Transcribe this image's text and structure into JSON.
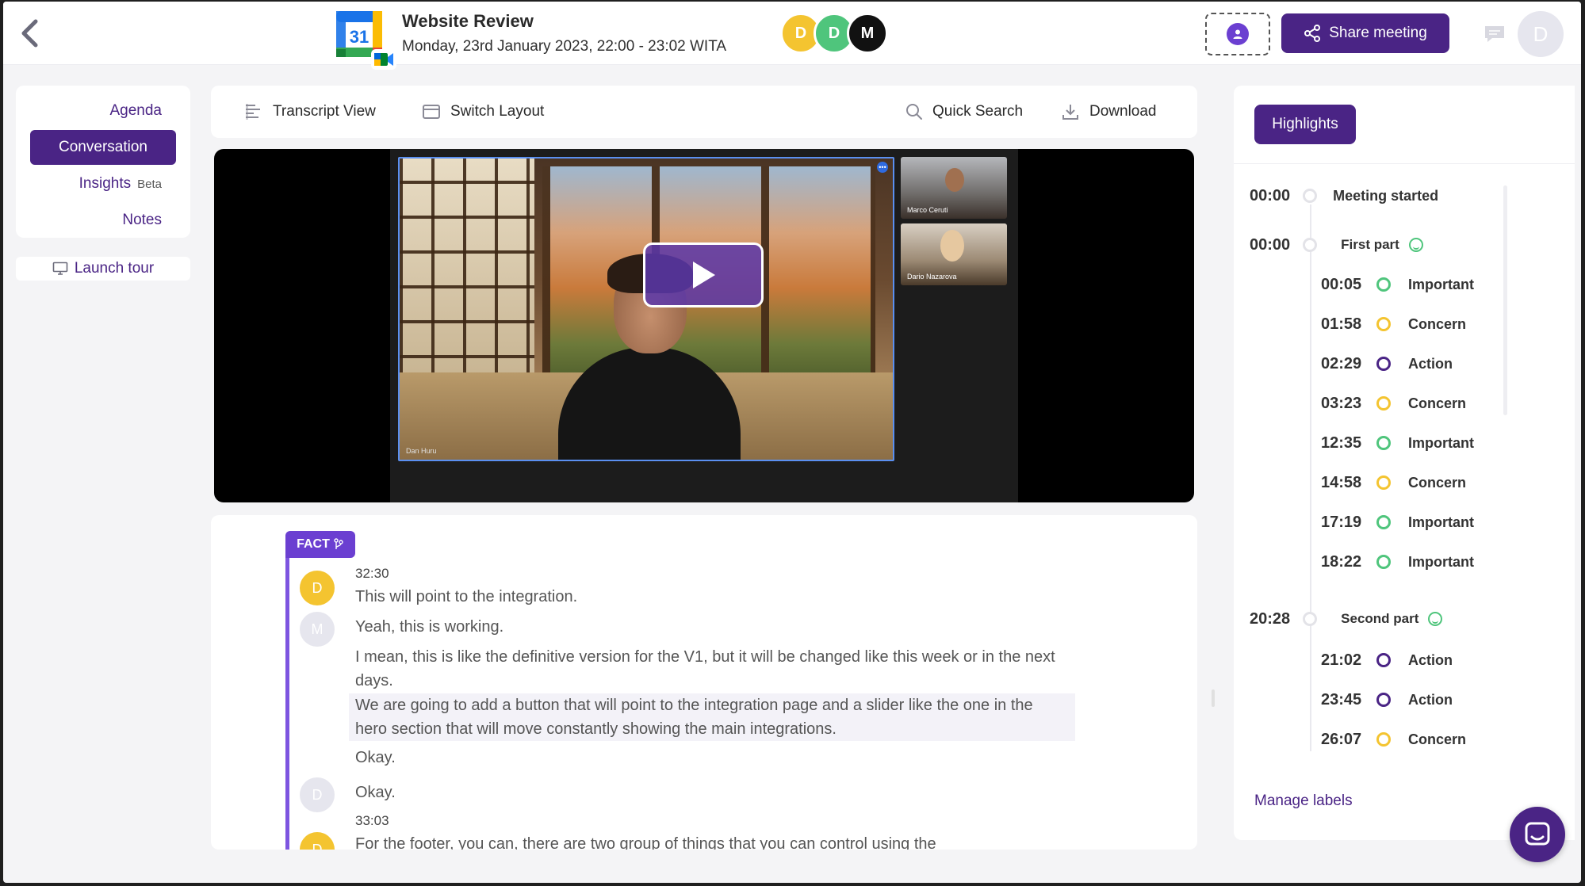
{
  "header": {
    "calendar_day": "31",
    "title": "Website Review",
    "date": "Monday, 23rd January 2023, 22:00 - 23:02 WITA",
    "participants": [
      {
        "initial": "D",
        "color": "#f4c430"
      },
      {
        "initial": "D",
        "color": "#4fc57c"
      },
      {
        "initial": "M",
        "color": "#111111"
      }
    ],
    "share_label": "Share meeting",
    "user_initial": "D"
  },
  "left_nav": {
    "items": [
      {
        "label": "Agenda"
      },
      {
        "label": "Conversation"
      },
      {
        "label": "Insights",
        "badge": "Beta"
      },
      {
        "label": "Notes"
      }
    ],
    "launch_tour": "Launch tour"
  },
  "toolbar": {
    "transcript_view": "Transcript View",
    "switch_layout": "Switch Layout",
    "quick_search": "Quick Search",
    "download": "Download"
  },
  "video": {
    "main_speaker": "Dan Huru",
    "thumbnails": [
      "Marco Ceruti",
      "Dario Nazarova"
    ]
  },
  "transcript": {
    "tag": "FACT",
    "entries": [
      {
        "avatar": "D",
        "time": "32:30",
        "text": "This will point to the integration."
      },
      {
        "avatar": "M",
        "text": "Yeah, this is working."
      },
      {
        "text": "I mean, this is like the definitive version for the V1, but it will be changed like this week or in the next days."
      },
      {
        "text": "We are going to add a button that will point to the integration page and a slider like the one in the hero section that will move constantly showing the main integrations."
      },
      {
        "text": "Okay."
      },
      {
        "avatar": "D",
        "text": "Okay."
      },
      {
        "avatar": "D",
        "time": "33:03",
        "text": "For the footer, you can, there are two group of things that you can control using the"
      }
    ]
  },
  "highlights": {
    "button": "Highlights",
    "sections": [
      {
        "time": "00:00",
        "label": "Meeting started"
      },
      {
        "time": "00:00",
        "label": "First part"
      },
      {
        "time": "20:28",
        "label": "Second part"
      }
    ],
    "items": [
      {
        "time": "00:05",
        "label": "Important",
        "color": "#4fc57c"
      },
      {
        "time": "01:58",
        "label": "Concern",
        "color": "#f4c430"
      },
      {
        "time": "02:29",
        "label": "Action",
        "color": "#4a2485"
      },
      {
        "time": "03:23",
        "label": "Concern",
        "color": "#f4c430"
      },
      {
        "time": "12:35",
        "label": "Important",
        "color": "#4fc57c"
      },
      {
        "time": "14:58",
        "label": "Concern",
        "color": "#f4c430"
      },
      {
        "time": "17:19",
        "label": "Important",
        "color": "#4fc57c"
      },
      {
        "time": "18:22",
        "label": "Important",
        "color": "#4fc57c"
      },
      {
        "time": "21:02",
        "label": "Action",
        "color": "#4a2485"
      },
      {
        "time": "23:45",
        "label": "Action",
        "color": "#4a2485"
      },
      {
        "time": "26:07",
        "label": "Concern",
        "color": "#f4c430"
      }
    ],
    "manage_labels": "Manage labels"
  },
  "colors": {
    "brand": "#4a2485",
    "accent": "#6b3fd1",
    "important": "#4fc57c",
    "concern": "#f4c430",
    "action": "#4a2485"
  }
}
